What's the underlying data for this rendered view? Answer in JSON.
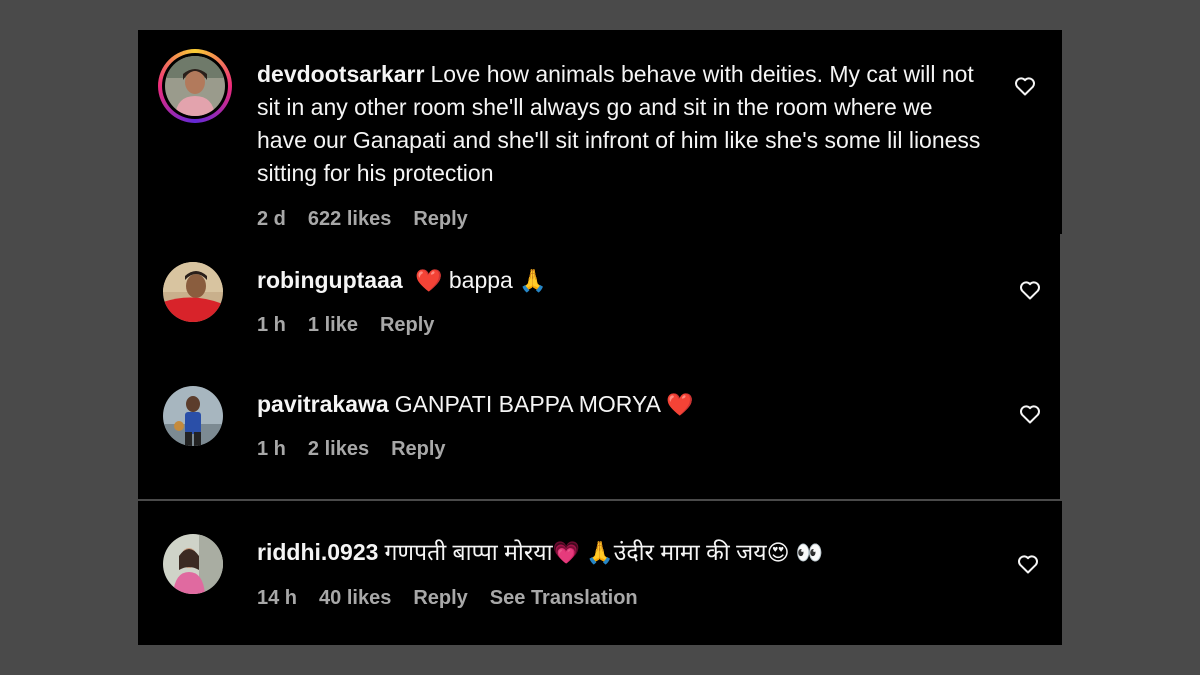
{
  "comments": [
    {
      "username": "devdootsarkarr",
      "text": "Love how animals behave with deities. My cat will not sit in any other room she'll always go and sit in the room where we have our Ganapati and she'll sit infront of him like she's some lil lioness sitting for his protection",
      "time": "2 d",
      "likes": "622 likes",
      "reply": "Reply",
      "has_story": true
    },
    {
      "username": "robinguptaaa",
      "text_before": "",
      "emoji1": "❤️",
      "text_mid": "bappa",
      "emoji2": "🙏",
      "time": "1 h",
      "likes": "1 like",
      "reply": "Reply"
    },
    {
      "username": "pavitrakawa",
      "text": "GANPATI BAPPA MORYA",
      "emoji1": "❤️",
      "time": "1 h",
      "likes": "2 likes",
      "reply": "Reply"
    },
    {
      "username": "riddhi.0923",
      "text_part1": "गणपती बाप्पा मोरया",
      "emoji1": "💗",
      "emoji2": "🙏",
      "text_part2": "उंदीर मामा की जय",
      "emoji3": "😍",
      "emoji4": "👀",
      "time": "14 h",
      "likes": "40 likes",
      "reply": "Reply",
      "translate": "See Translation"
    }
  ],
  "icons": {
    "like": "heart-outline-icon"
  },
  "colors": {
    "background": "#4a4a4a",
    "panel": "#000000",
    "text": "#f5f5f5",
    "meta": "#a8a8a8"
  }
}
